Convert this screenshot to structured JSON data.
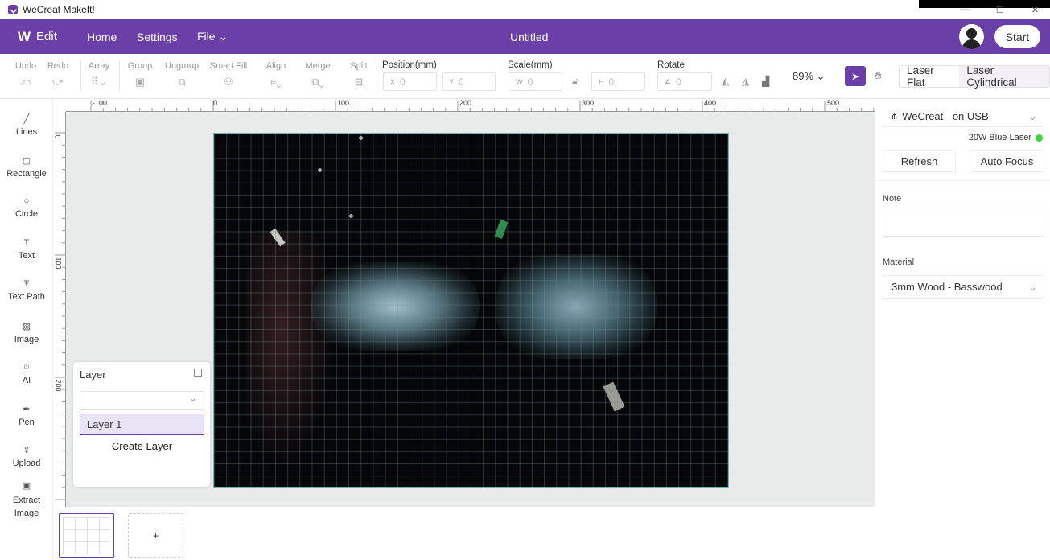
{
  "window": {
    "title": "WeCreat MakeIt!"
  },
  "topbar": {
    "brand_label": "Edit",
    "nav": [
      "Home",
      "Settings",
      "File"
    ],
    "document_title": "Untitled",
    "start_label": "Start"
  },
  "toolbar": {
    "undo": "Undo",
    "redo": "Redo",
    "array": "Array",
    "group": "Group",
    "ungroup": "Ungroup",
    "smart_fill": "Smart Fill",
    "align": "Align",
    "merge": "Merge",
    "split": "Split",
    "position_label": "Position(mm)",
    "x_prefix": "X",
    "x_value": "0",
    "y_prefix": "Y",
    "y_value": "0",
    "scale_label": "Scale(mm)",
    "w_prefix": "W",
    "w_value": "0",
    "h_prefix": "H",
    "h_value": "0",
    "rotate_label": "Rotate",
    "rotate_value": "0",
    "zoom": "89%",
    "laser_flat": "Laser Flat",
    "laser_cylindrical": "Laser Cylindrical"
  },
  "leftbar": {
    "tools": [
      "Lines",
      "Rectangle",
      "Circle",
      "Text",
      "Text Path",
      "Image",
      "AI",
      "Pen",
      "Upload",
      "Extract Image"
    ]
  },
  "ruler": {
    "h_ticks": [
      "-100",
      "0",
      "100",
      "200",
      "300",
      "400",
      "500"
    ],
    "v_ticks": [
      "0",
      "100",
      "200"
    ]
  },
  "layer_panel": {
    "title": "Layer",
    "layers": [
      "Layer 1"
    ],
    "create_label": "Create Layer"
  },
  "pages": {
    "add_label": "+"
  },
  "right_panel": {
    "device": "WeCreat - on USB",
    "laser": "20W Blue Laser",
    "refresh_label": "Refresh",
    "autofocus_label": "Auto Focus",
    "note_label": "Note",
    "material_label": "Material",
    "material_value": "3mm Wood - Basswood",
    "status_color": "#3ad63a"
  },
  "colors": {
    "accent": "#6a3fa8"
  }
}
